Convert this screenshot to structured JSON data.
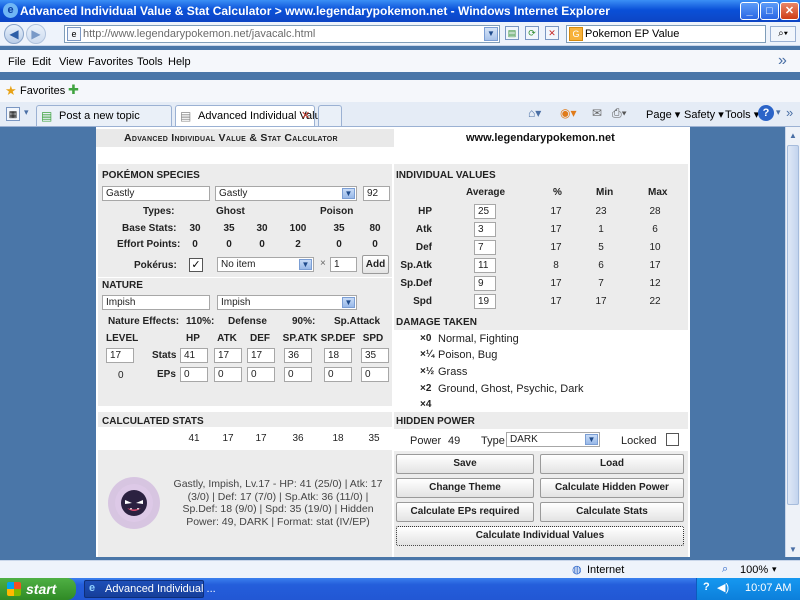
{
  "window": {
    "title": "Advanced Individual Value & Stat Calculator > www.legendarypokemon.net - Windows Internet Explorer"
  },
  "nav": {
    "url": "http://www.legendarypokemon.net/javacalc.html",
    "search_value": "Pokemon EP Value"
  },
  "menu": {
    "items": [
      "File",
      "Edit",
      "View",
      "Favorites",
      "Tools",
      "Help"
    ]
  },
  "favorites": {
    "label": "Favorites"
  },
  "tabs": [
    {
      "label": "Post a new topic"
    },
    {
      "label": "Advanced Individual Valu..."
    }
  ],
  "commandbar": {
    "page": "Page",
    "safety": "Safety",
    "tools": "Tools"
  },
  "calc": {
    "title": "Advanced Individual Value & Stat Calculator",
    "site": "www.legendarypokemon.net",
    "species": {
      "heading": "Pokémon Species",
      "name_value": "Gastly",
      "select_value": "Gastly",
      "number": "92",
      "types_label": "Types:",
      "type1": "Ghost",
      "type2": "Poison",
      "base_label": "Base Stats:",
      "base": [
        "30",
        "35",
        "30",
        "100",
        "35",
        "80"
      ],
      "effort_label": "Effort Points:",
      "effort": [
        "0",
        "0",
        "0",
        "2",
        "0",
        "0"
      ],
      "pokerus_label": "Pokérus:",
      "pokerus_check": "✓",
      "item_value": "No item",
      "item_mult": "×",
      "item_qty": "1",
      "add_label": "Add"
    },
    "nature": {
      "heading": "Nature",
      "name_value": "Impish",
      "select_value": "Impish",
      "effects_label": "Nature Effects:",
      "plus_pct": "110%:",
      "plus_stat": "Defense",
      "minus_pct": "90%:",
      "minus_stat": "Sp.Attack"
    },
    "stats": {
      "level_label": "LEVEL",
      "headers": [
        "HP",
        "ATK",
        "DEF",
        "SP.ATK",
        "SP.DEF",
        "SPD"
      ],
      "level_value": "17",
      "stats_label": "Stats",
      "stat_values": [
        "41",
        "17",
        "17",
        "36",
        "18",
        "35"
      ],
      "ep_total": "0",
      "eps_label": "EPs",
      "ep_values": [
        "0",
        "0",
        "0",
        "0",
        "0",
        "0"
      ]
    },
    "calculated": {
      "heading": "Calculated Stats",
      "values": [
        "41",
        "17",
        "17",
        "36",
        "18",
        "35"
      ]
    },
    "summary": "Gastly, Impish, Lv.17 - HP: 41 (25/0) | Atk: 17 (3/0) | Def: 17 (7/0) | Sp.Atk: 36 (11/0) | Sp.Def: 18 (9/0) | Spd: 35 (19/0) | Hidden Power: 49, DARK | Format: stat (IV/EP)",
    "ivs": {
      "heading": "Individual Values",
      "col_avg": "Average",
      "col_pct": "%",
      "col_min": "Min",
      "col_max": "Max",
      "rows": [
        {
          "stat": "HP",
          "avg": "25",
          "pct": "17",
          "min": "23",
          "max": "28"
        },
        {
          "stat": "Atk",
          "avg": "3",
          "pct": "17",
          "min": "1",
          "max": "6"
        },
        {
          "stat": "Def",
          "avg": "7",
          "pct": "17",
          "min": "5",
          "max": "10"
        },
        {
          "stat": "Sp.Atk",
          "avg": "11",
          "pct": "8",
          "min": "6",
          "max": "17"
        },
        {
          "stat": "Sp.Def",
          "avg": "9",
          "pct": "17",
          "min": "7",
          "max": "12"
        },
        {
          "stat": "Spd",
          "avg": "19",
          "pct": "17",
          "min": "17",
          "max": "22"
        }
      ]
    },
    "damage": {
      "heading": "Damage Taken",
      "rows": [
        {
          "mult": "×0",
          "types": "Normal, Fighting"
        },
        {
          "mult": "×¼",
          "types": "Poison, Bug"
        },
        {
          "mult": "×½",
          "types": "Grass"
        },
        {
          "mult": "×2",
          "types": "Ground, Ghost, Psychic, Dark"
        },
        {
          "mult": "×4",
          "types": ""
        }
      ]
    },
    "hidden_power": {
      "heading": "Hidden Power",
      "power_label": "Power",
      "power_value": "49",
      "type_label": "Type",
      "type_value": "DARK",
      "locked_label": "Locked"
    },
    "buttons": {
      "save": "Save",
      "load": "Load",
      "change_theme": "Change Theme",
      "calc_hp": "Calculate Hidden Power",
      "calc_eps": "Calculate EPs required",
      "calc_stats": "Calculate Stats",
      "calc_ivs": "Calculate Individual Values"
    }
  },
  "status": {
    "zone": "Internet",
    "zoom": "100%"
  },
  "taskbar": {
    "start": "start",
    "task": "Advanced Individual ...",
    "clock": "10:07 AM"
  }
}
